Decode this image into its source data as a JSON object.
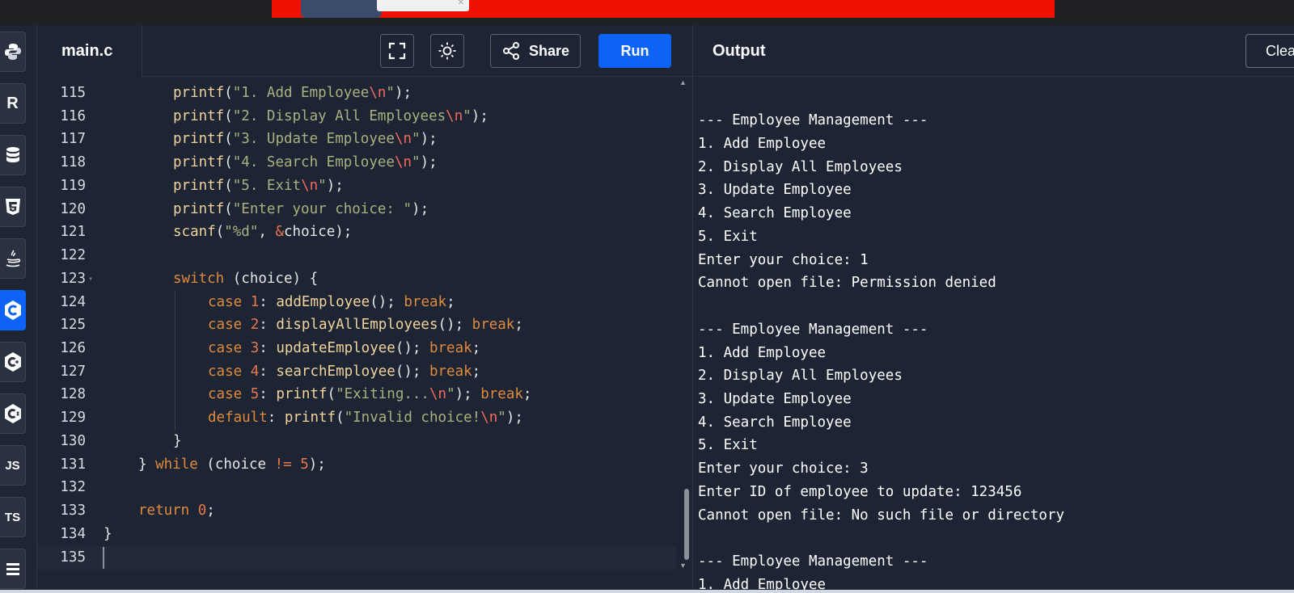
{
  "app": {
    "file_tab": "main.c",
    "share_label": "Share",
    "run_label": "Run",
    "output_title": "Output",
    "clear_label": "Clear",
    "accent_color": "#0c63f5",
    "icons": {
      "fullscreen": "fullscreen-icon",
      "theme": "sun-icon",
      "share": "share-icon"
    }
  },
  "sidebar": {
    "languages": [
      {
        "name": "python-icon",
        "label": ""
      },
      {
        "name": "r-icon",
        "label": "R"
      },
      {
        "name": "sql-icon",
        "label": ""
      },
      {
        "name": "html5-icon",
        "label": ""
      },
      {
        "name": "java-icon",
        "label": ""
      },
      {
        "name": "c-icon",
        "label": "",
        "active": true
      },
      {
        "name": "cpp-icon",
        "label": ""
      },
      {
        "name": "csharp-icon",
        "label": ""
      },
      {
        "name": "javascript-icon",
        "label": "JS"
      },
      {
        "name": "typescript-icon",
        "label": "TS"
      },
      {
        "name": "more-language-icon",
        "label": ""
      }
    ]
  },
  "editor": {
    "lines": [
      {
        "num": "115",
        "indent": 2,
        "tokens": [
          {
            "t": "printf",
            "c": "fn"
          },
          {
            "t": "(",
            "c": "p"
          },
          {
            "t": "\"1. Add Employee",
            "c": "str"
          },
          {
            "t": "\\n",
            "c": "esc"
          },
          {
            "t": "\"",
            "c": "str"
          },
          {
            "t": ");",
            "c": "p"
          }
        ]
      },
      {
        "num": "116",
        "indent": 2,
        "tokens": [
          {
            "t": "printf",
            "c": "fn"
          },
          {
            "t": "(",
            "c": "p"
          },
          {
            "t": "\"2. Display All Employees",
            "c": "str"
          },
          {
            "t": "\\n",
            "c": "esc"
          },
          {
            "t": "\"",
            "c": "str"
          },
          {
            "t": ");",
            "c": "p"
          }
        ]
      },
      {
        "num": "117",
        "indent": 2,
        "tokens": [
          {
            "t": "printf",
            "c": "fn"
          },
          {
            "t": "(",
            "c": "p"
          },
          {
            "t": "\"3. Update Employee",
            "c": "str"
          },
          {
            "t": "\\n",
            "c": "esc"
          },
          {
            "t": "\"",
            "c": "str"
          },
          {
            "t": ");",
            "c": "p"
          }
        ]
      },
      {
        "num": "118",
        "indent": 2,
        "tokens": [
          {
            "t": "printf",
            "c": "fn"
          },
          {
            "t": "(",
            "c": "p"
          },
          {
            "t": "\"4. Search Employee",
            "c": "str"
          },
          {
            "t": "\\n",
            "c": "esc"
          },
          {
            "t": "\"",
            "c": "str"
          },
          {
            "t": ");",
            "c": "p"
          }
        ]
      },
      {
        "num": "119",
        "indent": 2,
        "tokens": [
          {
            "t": "printf",
            "c": "fn"
          },
          {
            "t": "(",
            "c": "p"
          },
          {
            "t": "\"5. Exit",
            "c": "str"
          },
          {
            "t": "\\n",
            "c": "esc"
          },
          {
            "t": "\"",
            "c": "str"
          },
          {
            "t": ");",
            "c": "p"
          }
        ]
      },
      {
        "num": "120",
        "indent": 2,
        "tokens": [
          {
            "t": "printf",
            "c": "fn"
          },
          {
            "t": "(",
            "c": "p"
          },
          {
            "t": "\"Enter your choice: \"",
            "c": "str"
          },
          {
            "t": ");",
            "c": "p"
          }
        ]
      },
      {
        "num": "121",
        "indent": 2,
        "tokens": [
          {
            "t": "scanf",
            "c": "fn"
          },
          {
            "t": "(",
            "c": "p"
          },
          {
            "t": "\"%d\"",
            "c": "str"
          },
          {
            "t": ", ",
            "c": "p"
          },
          {
            "t": "&",
            "c": "op"
          },
          {
            "t": "choice);",
            "c": "p"
          }
        ]
      },
      {
        "num": "122",
        "indent": 0,
        "tokens": []
      },
      {
        "num": "123",
        "indent": 2,
        "fold": true,
        "tokens": [
          {
            "t": "switch",
            "c": "kw"
          },
          {
            "t": " (choice) {",
            "c": "p"
          }
        ]
      },
      {
        "num": "124",
        "indent": 3,
        "tokens": [
          {
            "t": "case ",
            "c": "kw"
          },
          {
            "t": "1",
            "c": "num"
          },
          {
            "t": ": ",
            "c": "p"
          },
          {
            "t": "addEmployee",
            "c": "fn"
          },
          {
            "t": "(); ",
            "c": "p"
          },
          {
            "t": "break",
            "c": "kw"
          },
          {
            "t": ";",
            "c": "p"
          }
        ]
      },
      {
        "num": "125",
        "indent": 3,
        "tokens": [
          {
            "t": "case ",
            "c": "kw"
          },
          {
            "t": "2",
            "c": "num"
          },
          {
            "t": ": ",
            "c": "p"
          },
          {
            "t": "displayAllEmployees",
            "c": "fn"
          },
          {
            "t": "(); ",
            "c": "p"
          },
          {
            "t": "break",
            "c": "kw"
          },
          {
            "t": ";",
            "c": "p"
          }
        ]
      },
      {
        "num": "126",
        "indent": 3,
        "tokens": [
          {
            "t": "case ",
            "c": "kw"
          },
          {
            "t": "3",
            "c": "num"
          },
          {
            "t": ": ",
            "c": "p"
          },
          {
            "t": "updateEmployee",
            "c": "fn"
          },
          {
            "t": "(); ",
            "c": "p"
          },
          {
            "t": "break",
            "c": "kw"
          },
          {
            "t": ";",
            "c": "p"
          }
        ]
      },
      {
        "num": "127",
        "indent": 3,
        "tokens": [
          {
            "t": "case ",
            "c": "kw"
          },
          {
            "t": "4",
            "c": "num"
          },
          {
            "t": ": ",
            "c": "p"
          },
          {
            "t": "searchEmployee",
            "c": "fn"
          },
          {
            "t": "(); ",
            "c": "p"
          },
          {
            "t": "break",
            "c": "kw"
          },
          {
            "t": ";",
            "c": "p"
          }
        ]
      },
      {
        "num": "128",
        "indent": 3,
        "tokens": [
          {
            "t": "case ",
            "c": "kw"
          },
          {
            "t": "5",
            "c": "num"
          },
          {
            "t": ": ",
            "c": "p"
          },
          {
            "t": "printf",
            "c": "fn"
          },
          {
            "t": "(",
            "c": "p"
          },
          {
            "t": "\"Exiting...",
            "c": "str"
          },
          {
            "t": "\\n",
            "c": "esc"
          },
          {
            "t": "\"",
            "c": "str"
          },
          {
            "t": "); ",
            "c": "p"
          },
          {
            "t": "break",
            "c": "kw"
          },
          {
            "t": ";",
            "c": "p"
          }
        ]
      },
      {
        "num": "129",
        "indent": 3,
        "tokens": [
          {
            "t": "default",
            "c": "kw"
          },
          {
            "t": ": ",
            "c": "p"
          },
          {
            "t": "printf",
            "c": "fn"
          },
          {
            "t": "(",
            "c": "p"
          },
          {
            "t": "\"Invalid choice!",
            "c": "str"
          },
          {
            "t": "\\n",
            "c": "esc"
          },
          {
            "t": "\"",
            "c": "str"
          },
          {
            "t": ");",
            "c": "p"
          }
        ]
      },
      {
        "num": "130",
        "indent": 2,
        "tokens": [
          {
            "t": "}",
            "c": "p"
          }
        ]
      },
      {
        "num": "131",
        "indent": 1,
        "tokens": [
          {
            "t": "} ",
            "c": "p"
          },
          {
            "t": "while",
            "c": "kw"
          },
          {
            "t": " (choice ",
            "c": "p"
          },
          {
            "t": "!=",
            "c": "op"
          },
          {
            "t": " ",
            "c": "p"
          },
          {
            "t": "5",
            "c": "num"
          },
          {
            "t": ");",
            "c": "p"
          }
        ]
      },
      {
        "num": "132",
        "indent": 0,
        "tokens": []
      },
      {
        "num": "133",
        "indent": 1,
        "tokens": [
          {
            "t": "return ",
            "c": "kw"
          },
          {
            "t": "0",
            "c": "num"
          },
          {
            "t": ";",
            "c": "p"
          }
        ]
      },
      {
        "num": "134",
        "indent": 0,
        "tokens": [
          {
            "t": "}",
            "c": "p"
          }
        ]
      },
      {
        "num": "135",
        "indent": 0,
        "current": true,
        "tokens": []
      }
    ]
  },
  "output": {
    "lines": [
      "",
      "--- Employee Management ---",
      "1. Add Employee",
      "2. Display All Employees",
      "3. Update Employee",
      "4. Search Employee",
      "5. Exit",
      "Enter your choice: 1",
      "Cannot open file: Permission denied",
      "",
      "--- Employee Management ---",
      "1. Add Employee",
      "2. Display All Employees",
      "3. Update Employee",
      "4. Search Employee",
      "5. Exit",
      "Enter your choice: 3",
      "Enter ID of employee to update: 123456",
      "Cannot open file: No such file or directory",
      "",
      "--- Employee Management ---",
      "1. Add Employee"
    ]
  }
}
